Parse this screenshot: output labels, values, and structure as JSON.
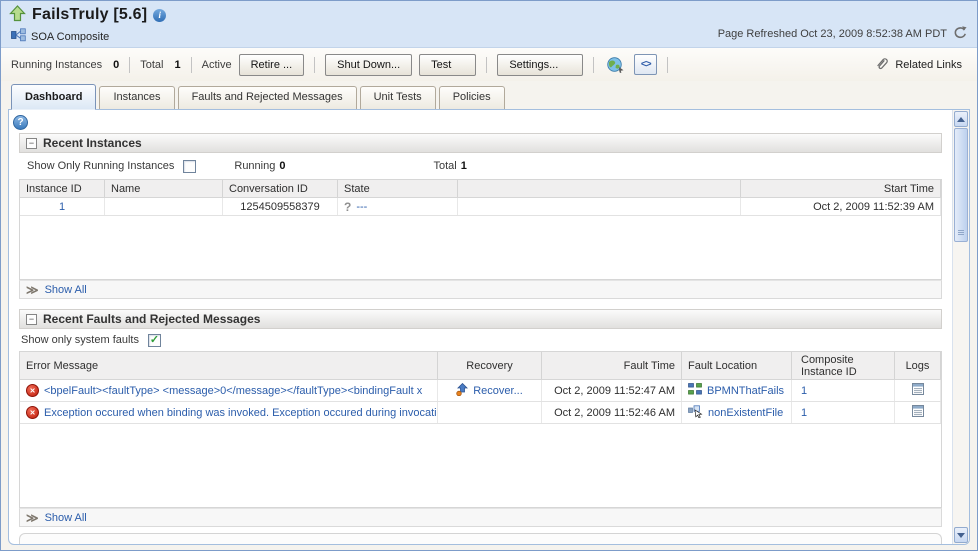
{
  "header": {
    "title": "FailsTruly [5.6]",
    "context_label": "SOA Composite",
    "page_refreshed": "Page Refreshed Oct 23, 2009 8:52:38 AM PDT"
  },
  "toolbar": {
    "running_instances_label": "Running Instances",
    "running_instances_value": "0",
    "total_label": "Total",
    "total_value": "1",
    "active_label": "Active",
    "retire_label": "Retire ...",
    "shutdown_label": "Shut Down...",
    "test_label": "Test",
    "settings_label": "Settings...",
    "related_links_label": "Related Links"
  },
  "tabs": [
    {
      "label": "Dashboard",
      "active": true
    },
    {
      "label": "Instances",
      "active": false
    },
    {
      "label": "Faults and Rejected Messages",
      "active": false
    },
    {
      "label": "Unit Tests",
      "active": false
    },
    {
      "label": "Policies",
      "active": false
    }
  ],
  "recent_instances": {
    "title": "Recent Instances",
    "filter_label": "Show Only Running Instances",
    "running_label": "Running",
    "running_value": "0",
    "total_label": "Total",
    "total_value": "1",
    "columns": {
      "instance_id": "Instance ID",
      "name": "Name",
      "conversation_id": "Conversation ID",
      "state": "State",
      "start_time": "Start Time"
    },
    "rows": [
      {
        "instance_id": "1",
        "name": "",
        "conversation_id": "1254509558379",
        "state": "---",
        "start_time": "Oct 2, 2009 11:52:39 AM"
      }
    ],
    "show_all_label": "Show All"
  },
  "recent_faults": {
    "title": "Recent Faults and Rejected Messages",
    "filter_label": "Show only system faults",
    "columns": {
      "error_message": "Error Message",
      "recovery": "Recovery",
      "fault_time": "Fault Time",
      "fault_location": "Fault Location",
      "composite_instance_id": "Composite Instance ID",
      "logs": "Logs"
    },
    "rows": [
      {
        "error_message": "<bpelFault><faultType> <message>0</message></faultType><bindingFault x",
        "recovery_label": "Recover...",
        "fault_time": "Oct 2, 2009 11:52:47 AM",
        "fault_location": "BPMNThatFails",
        "composite_instance_id": "1"
      },
      {
        "error_message": "Exception occured when binding was invoked. Exception occured during invocation",
        "recovery_label": "",
        "fault_time": "Oct 2, 2009 11:52:46 AM",
        "fault_location": "nonExistentFile",
        "composite_instance_id": "1"
      }
    ],
    "show_all_label": "Show All"
  },
  "icons": {
    "up-navigation-icon": "green up arrow",
    "info-icon": "i in blue circle",
    "soa-composite-icon": "component squares",
    "dropdown-arrow-icon": "▼",
    "refresh-icon": "circular arrow",
    "test-endpoint-icon": "globe",
    "xml-source-icon": "<>",
    "related-links-icon": "paperclip",
    "help-icon": "? in blue circle",
    "collapse-icon": "⊟",
    "unknown-state-icon": "?",
    "show-all-icon": "≫",
    "error-icon": "white ✕ in red circle",
    "recover-icon": "blue up arrow with orange ball",
    "bpmn-component-icon": "blue and green squares",
    "reference-file-icon": "component with cursor",
    "log-icon": "log grid",
    "scroll-up-icon": "▲",
    "scroll-down-icon": "▼"
  },
  "colors": {
    "header_bg": "#d7e5f6",
    "link": "#2b5dab",
    "error_red": "#c01c0a",
    "panel_border": "#a4bede",
    "section_header_bg": "#e1e0de",
    "check_green": "#2f9d38"
  }
}
